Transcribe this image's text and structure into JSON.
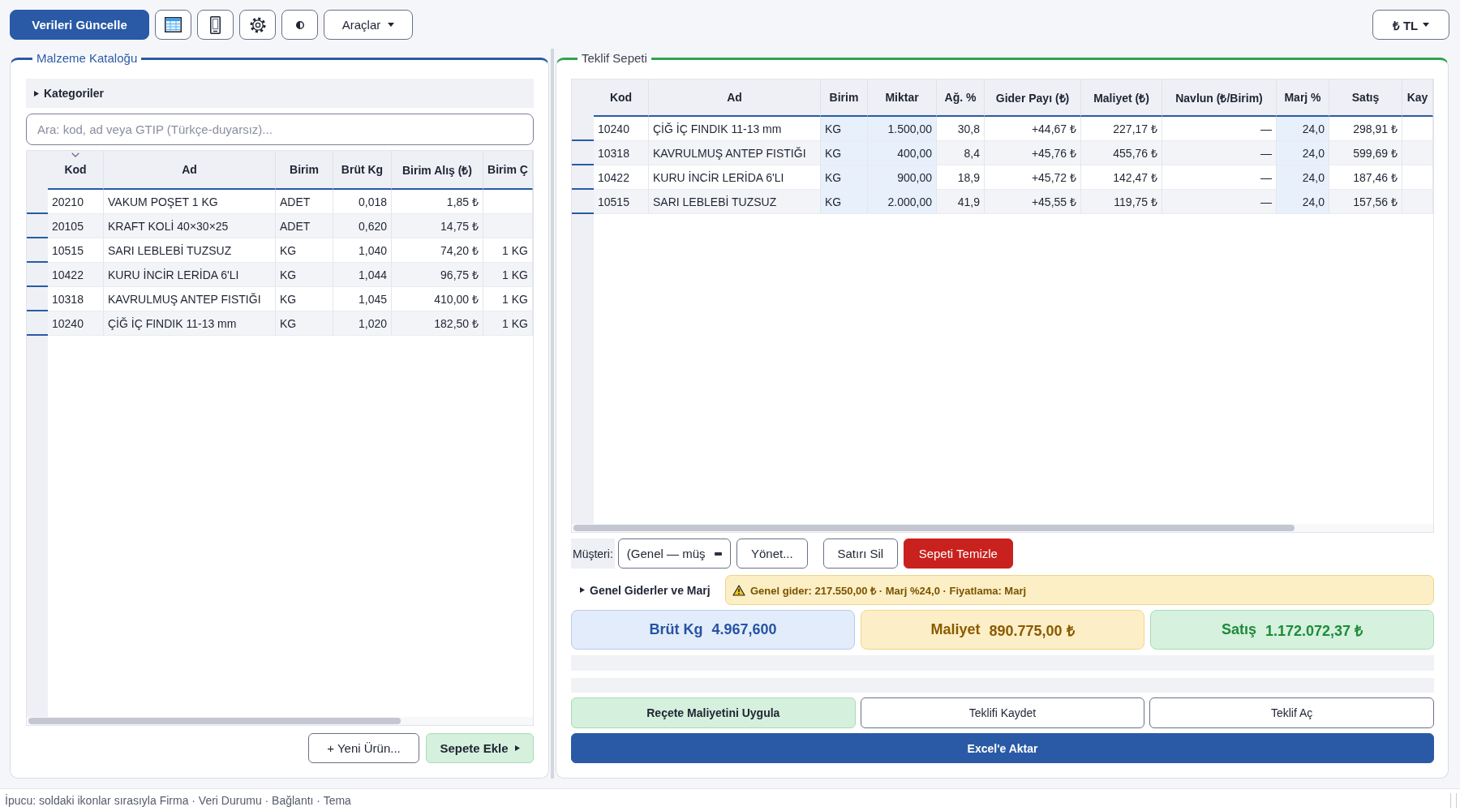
{
  "toolbar": {
    "update_button": "Verileri Güncelle",
    "tools_menu": "Araçlar",
    "currency_menu": "₺ TL"
  },
  "catalog": {
    "title": "Malzeme Kataloğu",
    "categories": {
      "label": "Kategoriler",
      "expanded": false
    },
    "search": {
      "placeholder": "Ara: kod, ad veya GTIP (Türkçe-duyarsız)..."
    },
    "table": {
      "columns": [
        {
          "label": "Kod",
          "kind": "text",
          "sorted": true
        },
        {
          "label": "Ad",
          "kind": "text",
          "sorted": false
        },
        {
          "label": "Birim",
          "kind": "text",
          "sorted": false
        },
        {
          "label": "Brüt Kg",
          "kind": "number",
          "sorted": false
        },
        {
          "label": "Birim Alış (₺)",
          "kind": "number",
          "sorted": false
        },
        {
          "label": "Birim Ç",
          "kind": "number",
          "sorted": false
        }
      ],
      "rows": [
        [
          "20210",
          "VAKUM POŞET 1 KG",
          "ADET",
          "0,018",
          "1,85 ₺",
          null
        ],
        [
          "20105",
          "KRAFT KOLİ 40×30×25",
          "ADET",
          "0,620",
          "14,75 ₺",
          null
        ],
        [
          "10515",
          "SARI LEBLEBİ TUZSUZ",
          "KG",
          "1,040",
          "74,20 ₺",
          "1 KG"
        ],
        [
          "10422",
          "KURU İNCİR LERİDA 6'LI",
          "KG",
          "1,044",
          "96,75 ₺",
          "1 KG"
        ],
        [
          "10318",
          "KAVRULMUŞ ANTEP FISTIĞI",
          "KG",
          "1,045",
          "410,00 ₺",
          "1 KG"
        ],
        [
          "10240",
          "ÇİĞ İÇ FINDIK 11-13 mm",
          "KG",
          "1,020",
          "182,50 ₺",
          "1 KG"
        ]
      ]
    },
    "new_product_button": "+ Yeni Ürün...",
    "add_to_cart_button": "Sepete Ekle"
  },
  "cart": {
    "title": "Teklif Sepeti",
    "table": {
      "columns": [
        {
          "label": "Kod",
          "kind": "text",
          "editable": false
        },
        {
          "label": "Ad",
          "kind": "text",
          "editable": false
        },
        {
          "label": "Birim",
          "kind": "text",
          "editable": true
        },
        {
          "label": "Miktar",
          "kind": "number",
          "editable": true
        },
        {
          "label": "Ağ. %",
          "kind": "number",
          "editable": false
        },
        {
          "label": "Gider Payı (₺)",
          "kind": "number",
          "editable": false
        },
        {
          "label": "Maliyet (₺)",
          "kind": "number",
          "editable": false
        },
        {
          "label": "Navlun (₺/Birim)",
          "kind": "number",
          "editable": false
        },
        {
          "label": "Marj %",
          "kind": "number",
          "editable": true
        },
        {
          "label": "Satış",
          "kind": "number",
          "editable": false
        },
        {
          "label": "Kay",
          "kind": "text",
          "editable": false
        }
      ],
      "rows": [
        [
          "10240",
          "ÇİĞ İÇ FINDIK 11-13 mm",
          "KG",
          "1.500,00",
          "30,8",
          "+44,67 ₺",
          "227,17 ₺",
          "—",
          "24,0",
          "298,91 ₺",
          null
        ],
        [
          "10318",
          "KAVRULMUŞ ANTEP FISTIĞI",
          "KG",
          "400,00",
          "8,4",
          "+45,76 ₺",
          "455,76 ₺",
          "—",
          "24,0",
          "599,69 ₺",
          null
        ],
        [
          "10422",
          "KURU İNCİR LERİDA 6'LI",
          "KG",
          "900,00",
          "18,9",
          "+45,72 ₺",
          "142,47 ₺",
          "—",
          "24,0",
          "187,46 ₺",
          null
        ],
        [
          "10515",
          "SARI LEBLEBİ TUZSUZ",
          "KG",
          "2.000,00",
          "41,9",
          "+45,55 ₺",
          "119,75 ₺",
          "—",
          "24,0",
          "157,56 ₺",
          null
        ]
      ]
    },
    "customer": {
      "label": "Müşteri:",
      "value": "(Genel — müş"
    },
    "row_buttons": [
      {
        "kind": "plain",
        "label": "Yönet..."
      },
      {
        "kind": "plain",
        "label": "Satırı Sil"
      },
      {
        "kind": "danger",
        "label": "Sepeti Temizle"
      }
    ],
    "expenses": {
      "label": "Genel Giderler ve Marj",
      "expanded": false
    },
    "warning": "Genel gider: 217.550,00 ₺ · Marj %24,0 · Fiyatlama: Marj",
    "totals": [
      {
        "kind": "weight",
        "label": "Brüt Kg",
        "value": "4.967,600"
      },
      {
        "kind": "cost",
        "label": "Maliyet",
        "value": "890.775,00 ₺"
      },
      {
        "kind": "sale",
        "label": "Satış",
        "value": "1.172.072,37 ₺"
      }
    ],
    "actions": [
      {
        "kind": "accent",
        "label": "Reçete Maliyetini Uygula"
      },
      {
        "kind": "plain",
        "label": "Teklifi Kaydet"
      },
      {
        "kind": "plain",
        "label": "Teklif Aç"
      }
    ],
    "export_button": "Excel'e Aktar"
  },
  "status_bar": "İpucu: soldaki ikonlar sırasıyla Firma · Veri Durumu · Bağlantı · Tema"
}
